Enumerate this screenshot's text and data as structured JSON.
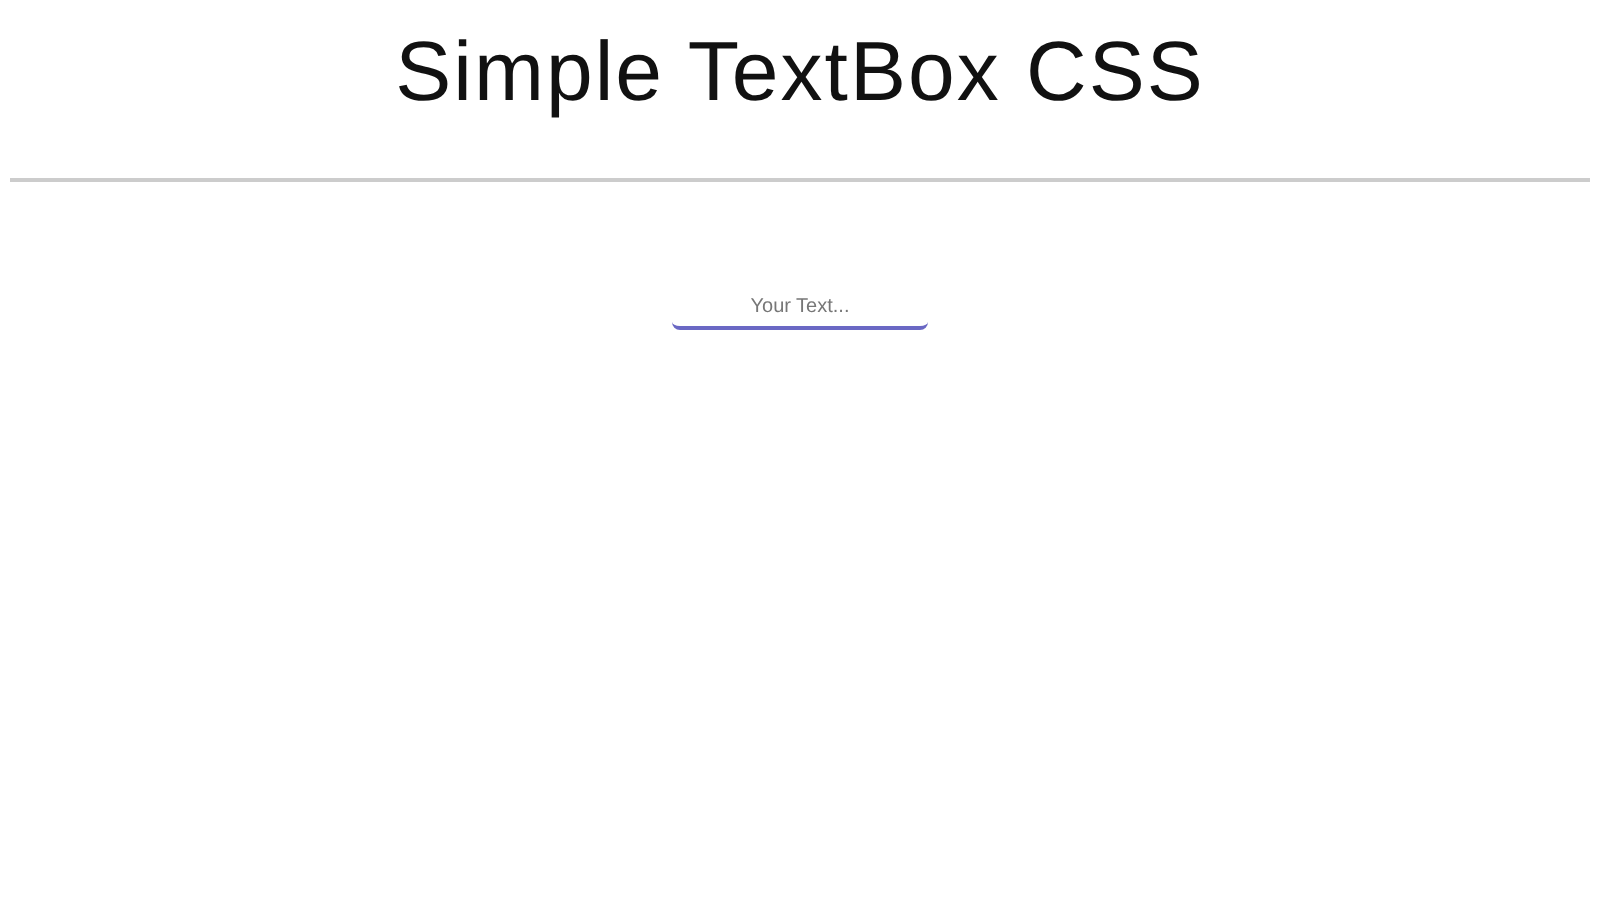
{
  "title": "Simple TextBox CSS",
  "field": {
    "placeholder": "Your Text..."
  }
}
